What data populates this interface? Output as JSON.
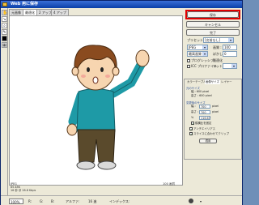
{
  "window": {
    "title": "Web 用に保存"
  },
  "tabs": [
    "元画像",
    "最適化",
    "2 アップ",
    "4 アップ"
  ],
  "right_panel": {
    "save_label": "保存",
    "cancel_label": "キャンセル",
    "done_label": "完了",
    "preset_label": "プリセット :",
    "preset_value": "[名前なし]",
    "format_value": "JPEG",
    "quality_label": "画質 :",
    "quality_value": "100",
    "quality_select": "最高画質",
    "blur_label": "ぼかし :",
    "blur_value": "0",
    "progressive_label": "プログレッシブ",
    "icc_label": "ICC プロファイル",
    "matte_label": "マット :",
    "optimized_label": "最適化"
  },
  "lower_panel": {
    "tabs": [
      "カラーテーブル",
      "画像サイズ",
      "レイヤー"
    ],
    "original_size_label": "元のサイズ",
    "original_width": "幅 : 600 pixel",
    "original_height": "高さ : 600 pixel",
    "new_size_label": "変更後のサイズ",
    "width_label": "幅 :",
    "width_value": "700",
    "height_label": "高さ :",
    "height_value": "700",
    "unit": "pixel",
    "percent_label": "%",
    "percent_value": "116.67",
    "constrain_label": "縦横比を固定",
    "quality_resample": "画質 :",
    "antialias_label": "アンチエイリアス",
    "clip_label": "スライスに合わせてクリップ",
    "apply_label": "適用"
  },
  "image_info": {
    "format": "JPEG",
    "size": "85.48K",
    "time": "16 秒 @ 28.8 Kbps",
    "quality": "100 画質"
  },
  "status_bar": {
    "zoom": "100%",
    "r_label": "R:",
    "g_label": "G:",
    "b_label": "B:",
    "alpha_label": "アルファ:",
    "hex_label": "16 進",
    "index_label": "インデックス:"
  }
}
